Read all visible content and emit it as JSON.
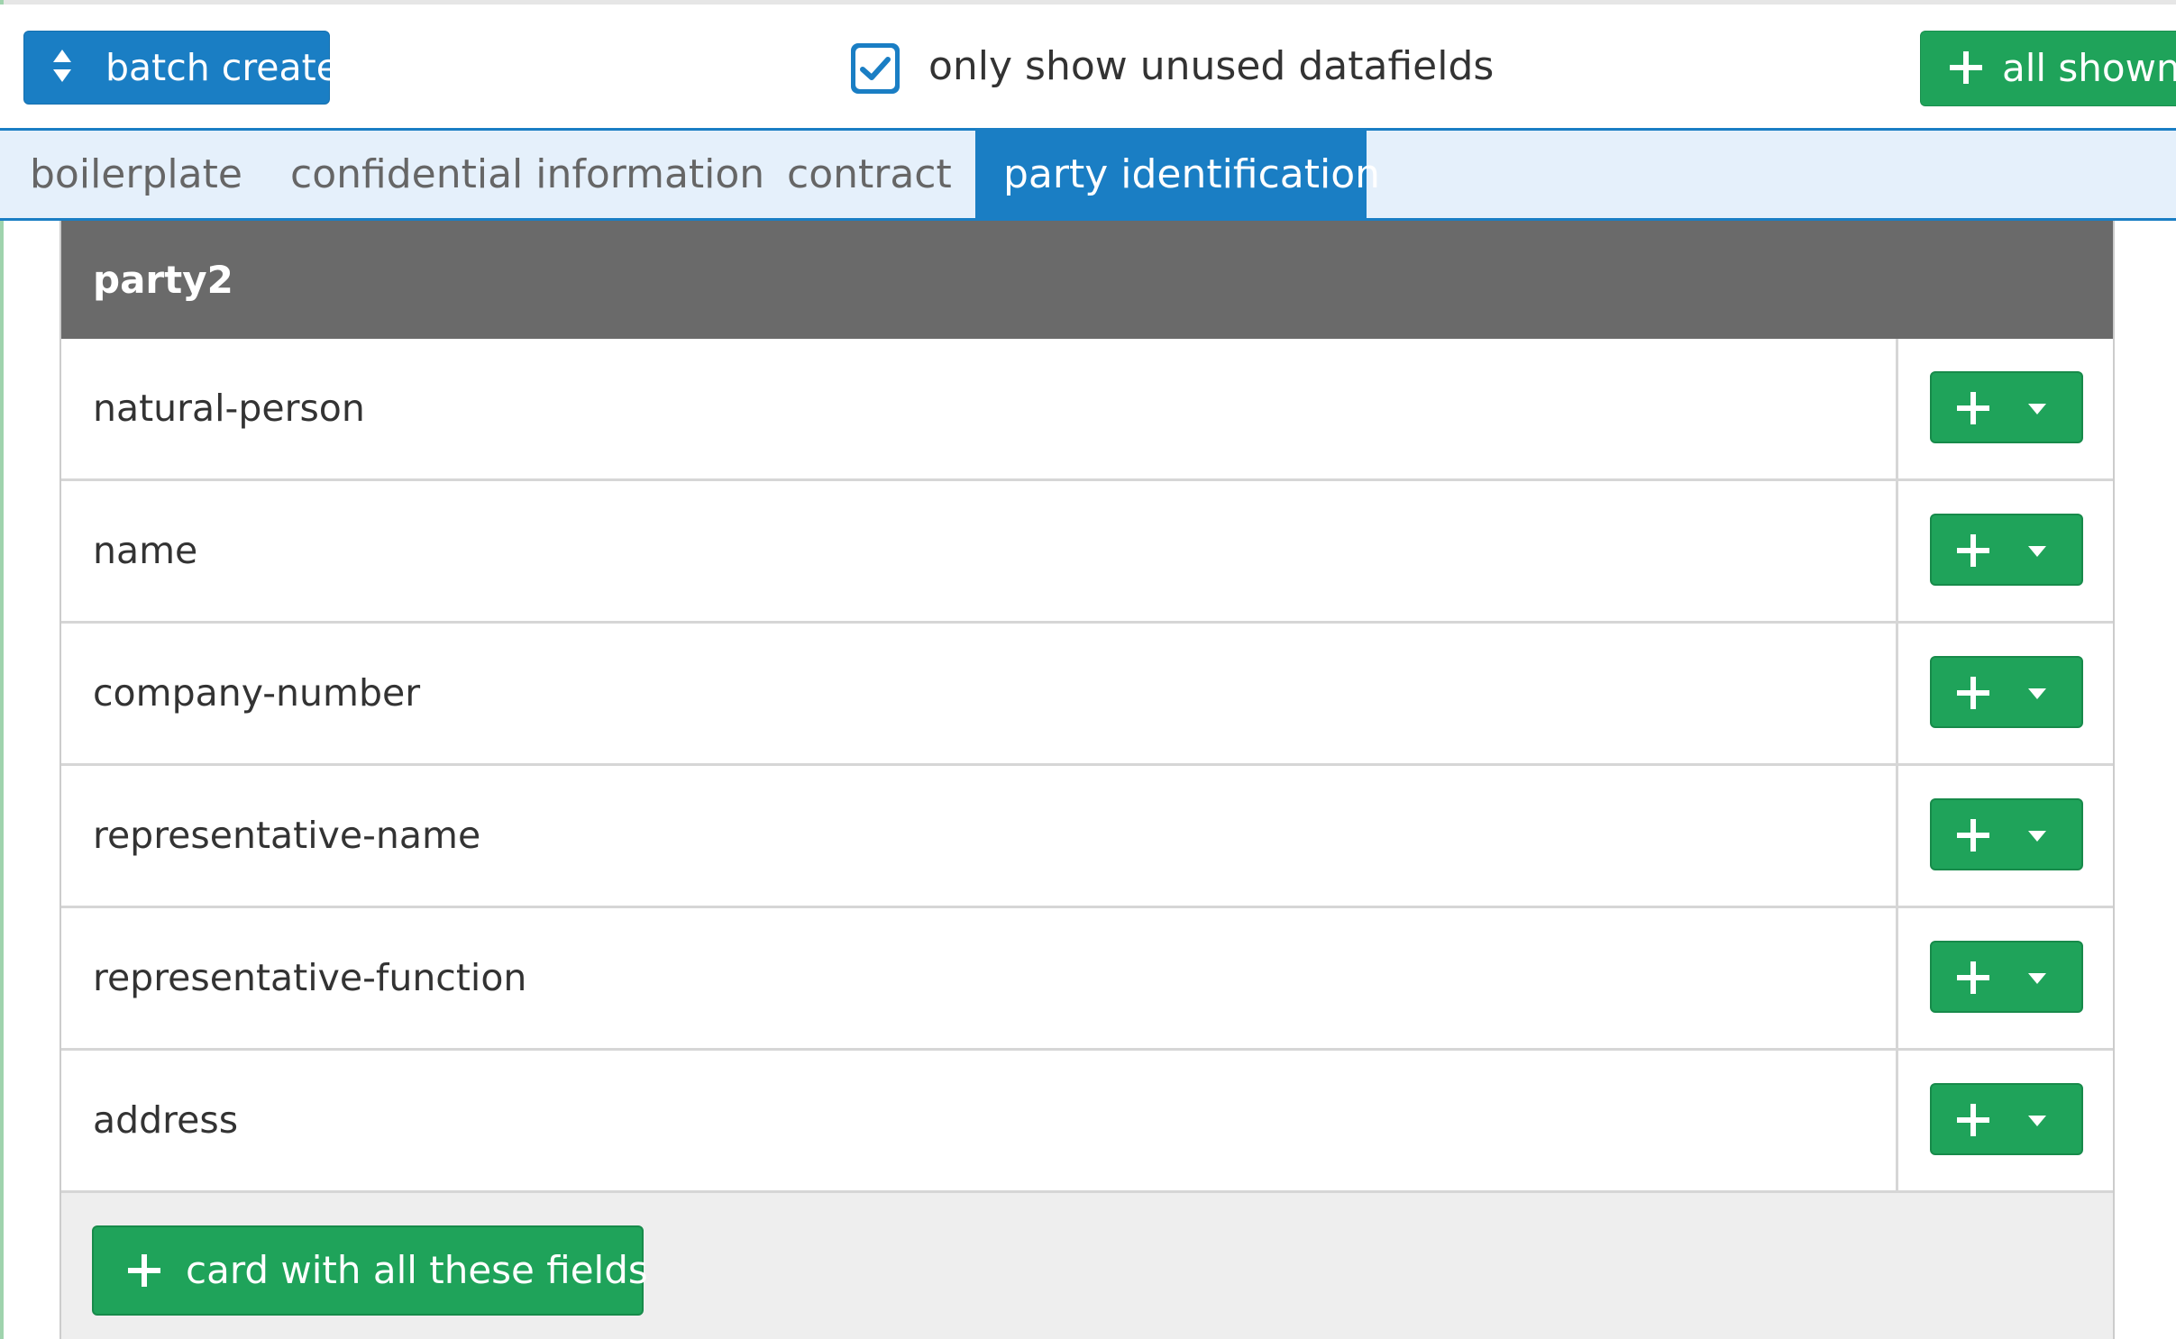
{
  "toolbar": {
    "batch_create_label": "batch create",
    "batch_create_icon": "sort-icon",
    "filter_checkbox_checked": true,
    "filter_checkbox_label": "only show unused datafields",
    "all_shown_label": "all shown",
    "all_shown_icon": "plus-icon"
  },
  "tabs": [
    {
      "label": "boilerplate",
      "active": false
    },
    {
      "label": "confidential information",
      "active": false
    },
    {
      "label": "contract",
      "active": false
    },
    {
      "label": "party identification",
      "active": true
    }
  ],
  "panel": {
    "title": "party2",
    "rows": [
      {
        "label": "natural-person",
        "action_icons": [
          "plus-icon",
          "caret-down-icon"
        ]
      },
      {
        "label": "name",
        "action_icons": [
          "plus-icon",
          "caret-down-icon"
        ]
      },
      {
        "label": "company-number",
        "action_icons": [
          "plus-icon",
          "caret-down-icon"
        ]
      },
      {
        "label": "representative-name",
        "action_icons": [
          "plus-icon",
          "caret-down-icon"
        ]
      },
      {
        "label": "representative-function",
        "action_icons": [
          "plus-icon",
          "caret-down-icon"
        ]
      },
      {
        "label": "address",
        "action_icons": [
          "plus-icon",
          "caret-down-icon"
        ]
      }
    ],
    "footer_button_label": "card with all these fields",
    "footer_button_icon": "plus-icon"
  },
  "colors": {
    "primary_blue": "#1a7ec4",
    "success_green": "#1fa35a",
    "tab_bar_background": "#e5f0fb",
    "panel_header": "#6a6a6a",
    "footer_background": "#eeeeee"
  }
}
